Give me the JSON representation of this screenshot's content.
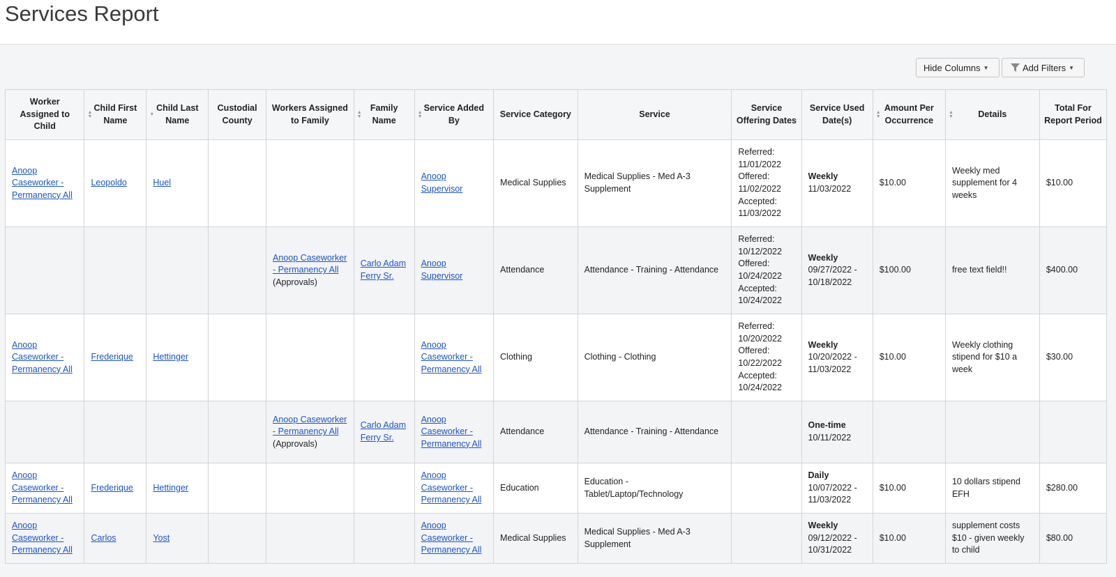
{
  "page": {
    "title": "Services Report",
    "hide_columns_label": "Hide Columns",
    "add_filters_label": "Add Filters"
  },
  "table": {
    "headers": [
      "Worker Assigned to Child",
      "Child First Name",
      "Child Last Name",
      "Custodial County",
      "Workers Assigned to Family",
      "Family Name",
      "Service Added By",
      "Service Category",
      "Service",
      "Service Offering Dates",
      "Service Used Date(s)",
      "Amount Per Occurrence",
      "Details",
      "Total For Report Period"
    ],
    "rows": [
      {
        "worker_child": "Anoop Caseworker - Permanency All",
        "first_name": "Leopoldo",
        "last_name": "Huel",
        "county": "",
        "workers_family": "",
        "workers_family_note": "",
        "family_name": "",
        "added_by": "Anoop Supervisor",
        "category": "Medical Supplies",
        "service": "Medical Supplies - Med A-3 Supplement",
        "offering_dates": [
          "Referred:",
          "11/01/2022",
          "Offered:",
          "11/02/2022",
          "Accepted:",
          "11/03/2022"
        ],
        "used_freq": "Weekly",
        "used_dates": "11/03/2022",
        "amount": "$10.00",
        "details": "Weekly med supplement for 4 weeks",
        "total": "$10.00"
      },
      {
        "worker_child": "",
        "first_name": "",
        "last_name": "",
        "county": "",
        "workers_family": "Anoop Caseworker - Permanency All",
        "workers_family_note": "(Approvals)",
        "family_name": "Carlo Adam Ferry Sr.",
        "added_by": "Anoop Supervisor",
        "category": "Attendance",
        "service": "Attendance - Training - Attendance",
        "offering_dates": [
          "Referred:",
          "10/12/2022",
          "Offered:",
          "10/24/2022",
          "Accepted:",
          "10/24/2022"
        ],
        "used_freq": "Weekly",
        "used_dates": "09/27/2022 - 10/18/2022",
        "amount": "$100.00",
        "details": "free text field!!",
        "total": "$400.00"
      },
      {
        "worker_child": "Anoop Caseworker - Permanency All",
        "first_name": "Frederique",
        "last_name": "Hettinger",
        "county": "",
        "workers_family": "",
        "workers_family_note": "",
        "family_name": "",
        "added_by": "Anoop Caseworker - Permanency All",
        "category": "Clothing",
        "service": "Clothing - Clothing",
        "offering_dates": [
          "Referred:",
          "10/20/2022",
          "Offered:",
          "10/22/2022",
          "Accepted:",
          "10/24/2022"
        ],
        "used_freq": "Weekly",
        "used_dates": "10/20/2022 - 11/03/2022",
        "amount": "$10.00",
        "details": "Weekly clothing stipend for $10 a week",
        "total": "$30.00"
      },
      {
        "worker_child": "",
        "first_name": "",
        "last_name": "",
        "county": "",
        "workers_family": "Anoop Caseworker - Permanency All",
        "workers_family_note": "(Approvals)",
        "family_name": "Carlo Adam Ferry Sr.",
        "added_by": "Anoop Caseworker - Permanency All",
        "category": "Attendance",
        "service": "Attendance - Training - Attendance",
        "offering_dates": [],
        "used_freq": "One-time",
        "used_dates": "10/11/2022",
        "amount": "",
        "details": "",
        "total": ""
      },
      {
        "worker_child": "Anoop Caseworker - Permanency All",
        "first_name": "Frederique",
        "last_name": "Hettinger",
        "county": "",
        "workers_family": "",
        "workers_family_note": "",
        "family_name": "",
        "added_by": "Anoop Caseworker - Permanency All",
        "category": "Education",
        "service": "Education - Tablet/Laptop/Technology",
        "offering_dates": [],
        "used_freq": "Daily",
        "used_dates": "10/07/2022 - 11/03/2022",
        "amount": "$10.00",
        "details": "10 dollars stipend EFH",
        "total": "$280.00"
      },
      {
        "worker_child": "Anoop Caseworker - Permanency All",
        "first_name": "Carlos",
        "last_name": "Yost",
        "county": "",
        "workers_family": "",
        "workers_family_note": "",
        "family_name": "",
        "added_by": "Anoop Caseworker - Permanency All",
        "category": "Medical Supplies",
        "service": "Medical Supplies - Med A-3 Supplement",
        "offering_dates": [],
        "used_freq": "Weekly",
        "used_dates": "09/12/2022 - 10/31/2022",
        "amount": "$10.00",
        "details": "supplement costs $10 - given weekly to child",
        "total": "$80.00"
      }
    ]
  }
}
